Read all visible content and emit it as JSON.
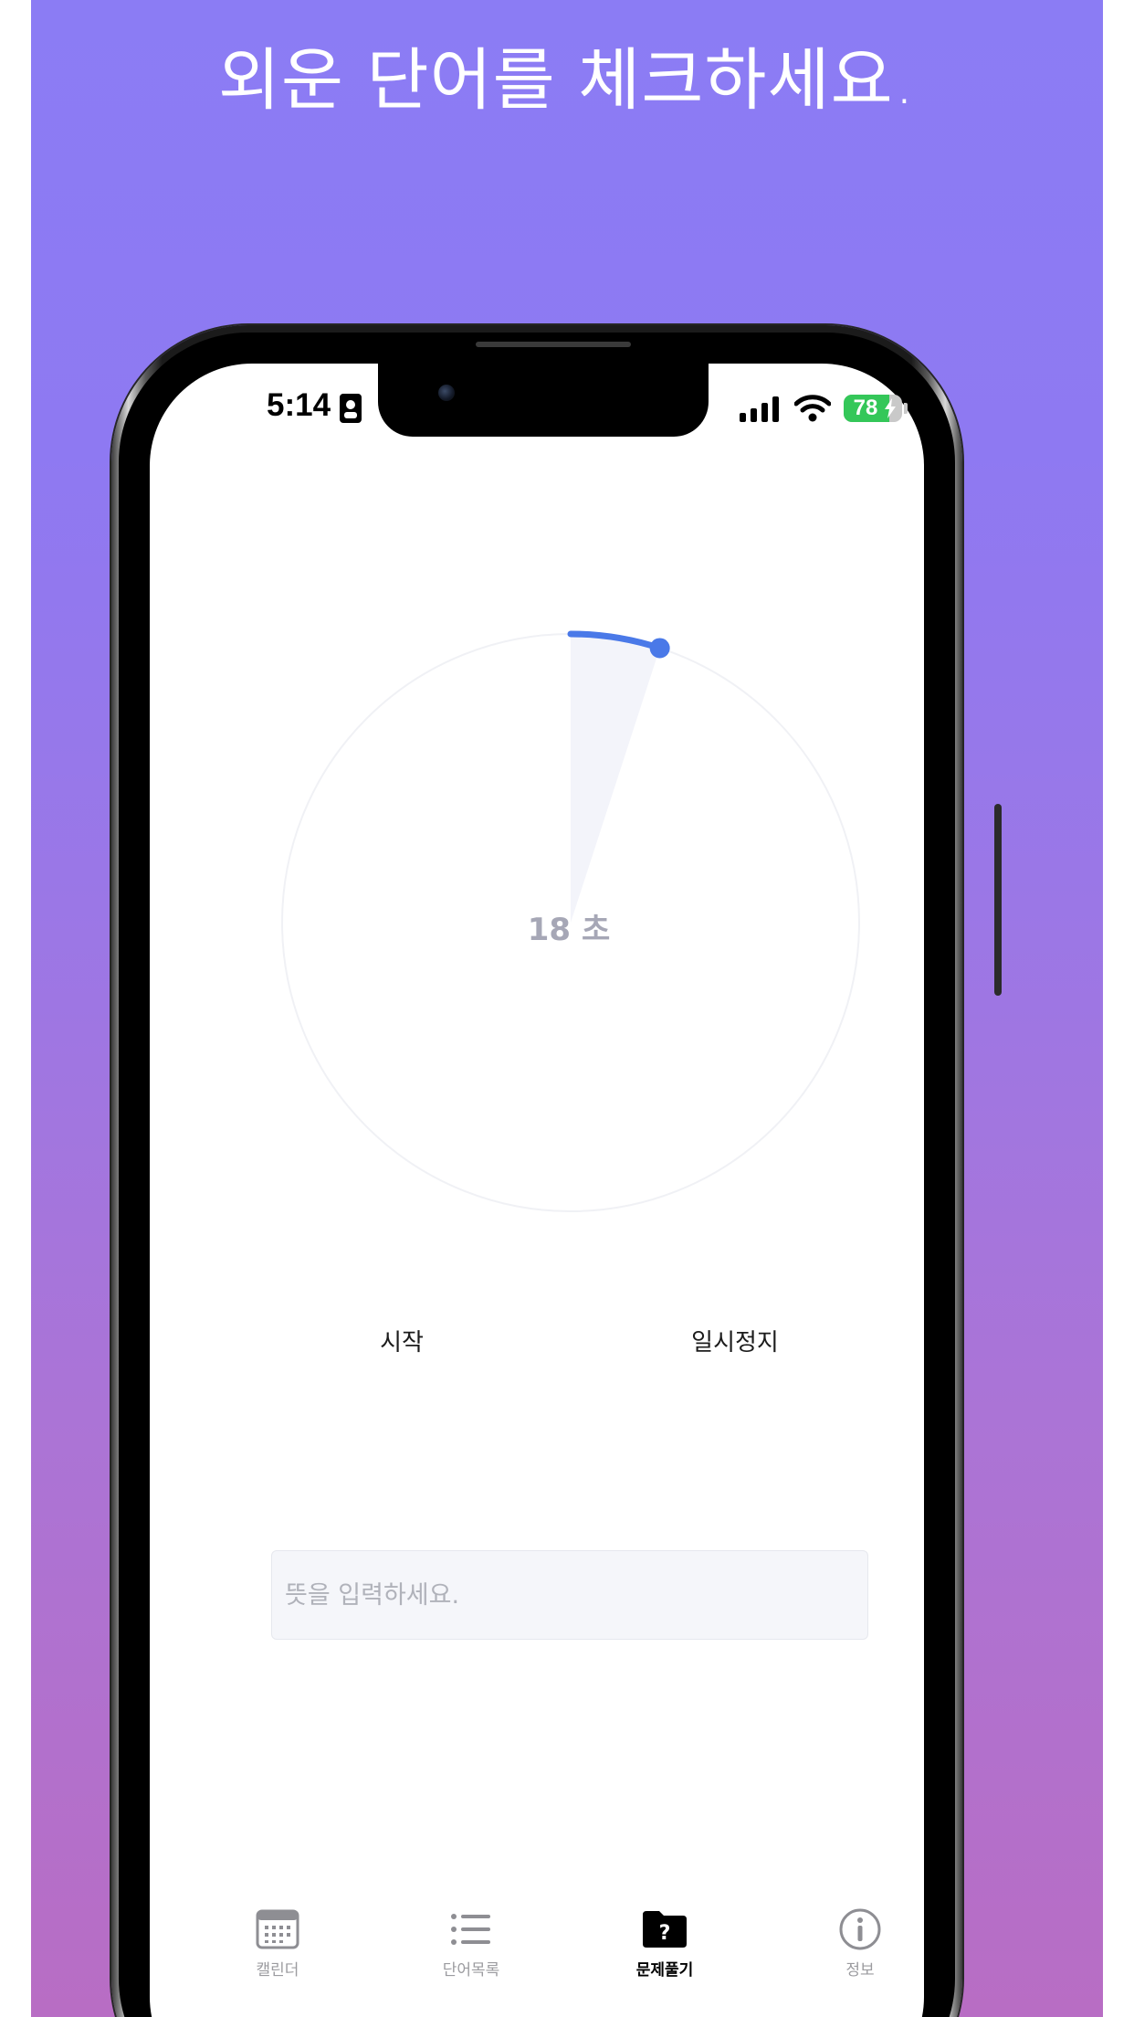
{
  "promo": {
    "headline": "외운 단어를 체크하세요.",
    "gradient_colors": [
      "#8b7cf4",
      "#b86dc4"
    ]
  },
  "status_bar": {
    "time": "5:14",
    "battery_percent": "78",
    "battery_level": 0.78,
    "icons": [
      "id-card-icon",
      "cellular-signal-icon",
      "wifi-icon",
      "battery-charging-icon"
    ]
  },
  "timer": {
    "value": "18",
    "unit": "초",
    "progress_fraction": 0.05,
    "accent_color": "#4a79e8",
    "sector_color": "#f3f4fa"
  },
  "controls": {
    "start_label": "시작",
    "pause_label": "일시정지"
  },
  "answer_input": {
    "placeholder": "뜻을 입력하세요.",
    "value": ""
  },
  "tab_bar": {
    "tabs": [
      {
        "label": "캘린더",
        "icon": "calendar-icon",
        "active": false
      },
      {
        "label": "단어목록",
        "icon": "list-icon",
        "active": false
      },
      {
        "label": "문제풀기",
        "icon": "question-folder-icon",
        "active": true
      },
      {
        "label": "정보",
        "icon": "info-icon",
        "active": false
      }
    ]
  }
}
